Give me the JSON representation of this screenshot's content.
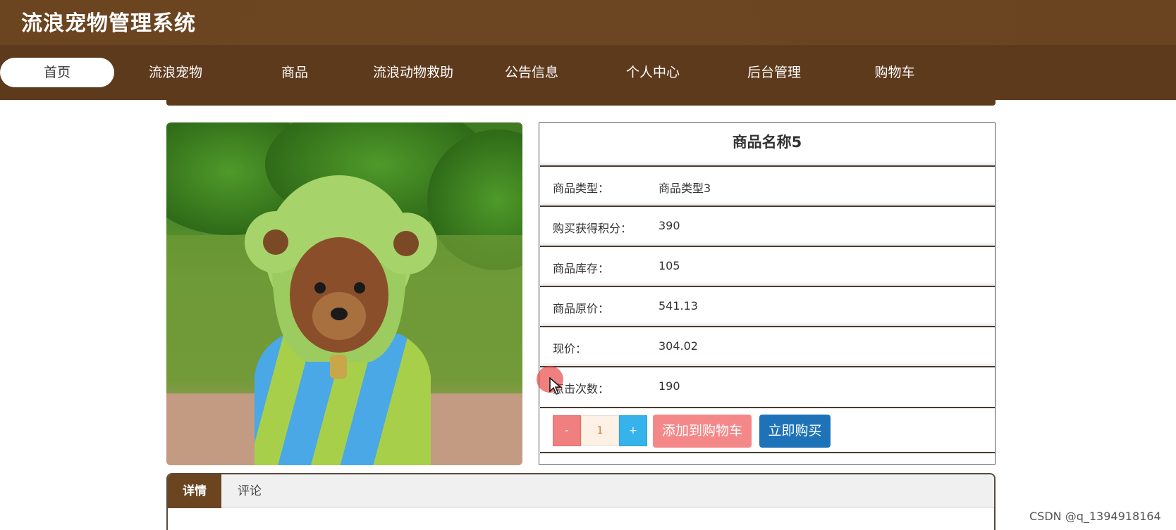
{
  "header": {
    "site_title": "流浪宠物管理系统"
  },
  "nav": {
    "items": [
      {
        "label": "首页",
        "active": true
      },
      {
        "label": "流浪宠物"
      },
      {
        "label": "商品"
      },
      {
        "label": "流浪动物救助"
      },
      {
        "label": "公告信息"
      },
      {
        "label": "个人中心"
      },
      {
        "label": "后台管理"
      },
      {
        "label": "购物车"
      }
    ]
  },
  "product": {
    "name": "商品名称5",
    "image_subject": "dog-in-frog-hoodie-photo",
    "details": [
      {
        "label": "商品类型：",
        "value": "商品类型3"
      },
      {
        "label": "购买获得积分：",
        "value": "390"
      },
      {
        "label": "商品库存：",
        "value": "105"
      },
      {
        "label": "商品原价：",
        "value": "541.13"
      },
      {
        "label": "现价：",
        "value": "304.02"
      },
      {
        "label": "点击次数：",
        "value": "190"
      }
    ]
  },
  "actions": {
    "minus": "-",
    "quantity": "1",
    "plus": "+",
    "add_to_cart": "添加到购物车",
    "buy_now": "立即购买"
  },
  "tabs": {
    "items": [
      {
        "label": "详情",
        "active": true
      },
      {
        "label": "评论"
      }
    ]
  },
  "watermark": "CSDN @q_1394918164",
  "colors": {
    "header_bg": "#6b4420",
    "nav_bg": "#5e3a1c",
    "minus_btn": "#f08080",
    "plus_btn": "#36b3ea",
    "add_cart_btn": "#f48888",
    "buy_now_btn": "#1e73b8"
  }
}
